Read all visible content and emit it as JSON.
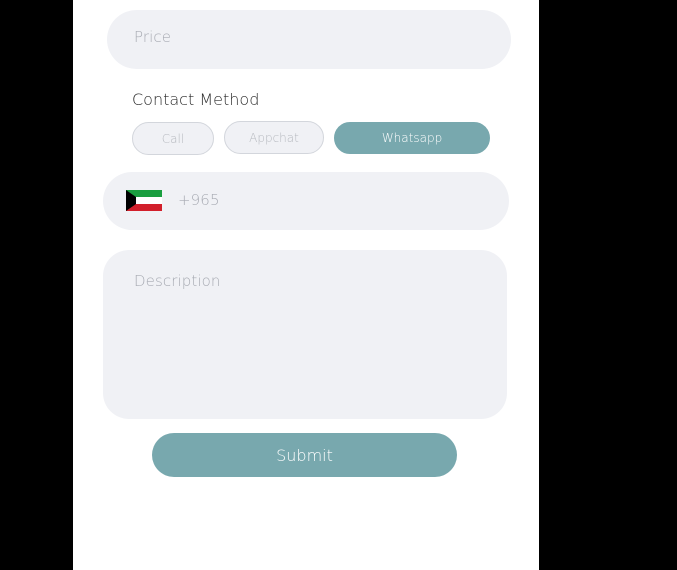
{
  "form": {
    "price_placeholder": "Price",
    "contact_method_label": "Contact Method",
    "contact_options": [
      {
        "label": "Call",
        "selected": false
      },
      {
        "label": "Appchat",
        "selected": false
      },
      {
        "label": "Whatsapp",
        "selected": true
      }
    ],
    "phone_country_icon": "kuwait-flag-icon",
    "phone_prefix": "+965",
    "description_placeholder": "Description",
    "submit_label": "Submit"
  },
  "colors": {
    "accent": "#78a8ae",
    "field_background": "#f0f1f5",
    "outer_background": "#000000"
  }
}
